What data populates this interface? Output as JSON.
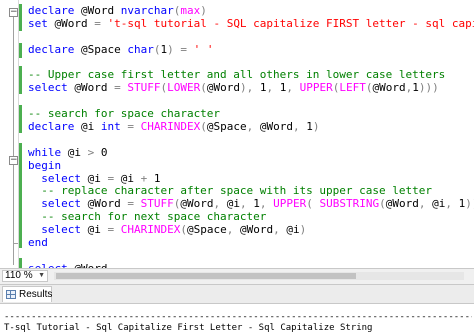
{
  "editor": {
    "lines": [
      [
        {
          "t": "declare",
          "c": "kw"
        },
        {
          "t": " @Word ",
          "c": "pl"
        },
        {
          "t": "nvarchar",
          "c": "kw"
        },
        {
          "t": "(",
          "c": "gr"
        },
        {
          "t": "max",
          "c": "fn"
        },
        {
          "t": ")",
          "c": "gr"
        }
      ],
      [
        {
          "t": "set",
          "c": "kw"
        },
        {
          "t": " @Word ",
          "c": "pl"
        },
        {
          "t": "=",
          "c": "gr"
        },
        {
          "t": " ",
          "c": "pl"
        },
        {
          "t": "'t-sql tutorial - SQL capitalize FIRST letter - sql capitalize string'",
          "c": "str"
        }
      ],
      [],
      [
        {
          "t": "declare",
          "c": "kw"
        },
        {
          "t": " @Space ",
          "c": "pl"
        },
        {
          "t": "char",
          "c": "kw"
        },
        {
          "t": "(",
          "c": "gr"
        },
        {
          "t": "1",
          "c": "pl"
        },
        {
          "t": ")",
          "c": "gr"
        },
        {
          "t": " ",
          "c": "pl"
        },
        {
          "t": "=",
          "c": "gr"
        },
        {
          "t": " ",
          "c": "pl"
        },
        {
          "t": "' '",
          "c": "str"
        }
      ],
      [],
      [
        {
          "t": "-- Upper case first letter and all others in lower case letters",
          "c": "cm"
        }
      ],
      [
        {
          "t": "select",
          "c": "kw"
        },
        {
          "t": " @Word ",
          "c": "pl"
        },
        {
          "t": "=",
          "c": "gr"
        },
        {
          "t": " ",
          "c": "pl"
        },
        {
          "t": "STUFF",
          "c": "fn"
        },
        {
          "t": "(",
          "c": "gr"
        },
        {
          "t": "LOWER",
          "c": "fn"
        },
        {
          "t": "(",
          "c": "gr"
        },
        {
          "t": "@Word",
          "c": "pl"
        },
        {
          "t": "),",
          "c": "gr"
        },
        {
          "t": " 1",
          "c": "pl"
        },
        {
          "t": ",",
          "c": "gr"
        },
        {
          "t": " 1",
          "c": "pl"
        },
        {
          "t": ",",
          "c": "gr"
        },
        {
          "t": " ",
          "c": "pl"
        },
        {
          "t": "UPPER",
          "c": "fn"
        },
        {
          "t": "(",
          "c": "gr"
        },
        {
          "t": "LEFT",
          "c": "fn"
        },
        {
          "t": "(",
          "c": "gr"
        },
        {
          "t": "@Word",
          "c": "pl"
        },
        {
          "t": ",",
          "c": "gr"
        },
        {
          "t": "1",
          "c": "pl"
        },
        {
          "t": ")))",
          "c": "gr"
        }
      ],
      [],
      [
        {
          "t": "-- search for space character",
          "c": "cm"
        }
      ],
      [
        {
          "t": "declare",
          "c": "kw"
        },
        {
          "t": " @i ",
          "c": "pl"
        },
        {
          "t": "int",
          "c": "kw"
        },
        {
          "t": " ",
          "c": "pl"
        },
        {
          "t": "=",
          "c": "gr"
        },
        {
          "t": " ",
          "c": "pl"
        },
        {
          "t": "CHARINDEX",
          "c": "fn"
        },
        {
          "t": "(",
          "c": "gr"
        },
        {
          "t": "@Space",
          "c": "pl"
        },
        {
          "t": ",",
          "c": "gr"
        },
        {
          "t": " @Word",
          "c": "pl"
        },
        {
          "t": ",",
          "c": "gr"
        },
        {
          "t": " 1",
          "c": "pl"
        },
        {
          "t": ")",
          "c": "gr"
        }
      ],
      [],
      [
        {
          "t": "while",
          "c": "kw"
        },
        {
          "t": " @i ",
          "c": "pl"
        },
        {
          "t": ">",
          "c": "gr"
        },
        {
          "t": " 0",
          "c": "pl"
        }
      ],
      [
        {
          "t": "begin",
          "c": "kw"
        }
      ],
      [
        {
          "t": "  ",
          "c": "pl"
        },
        {
          "t": "select",
          "c": "kw"
        },
        {
          "t": " @i ",
          "c": "pl"
        },
        {
          "t": "=",
          "c": "gr"
        },
        {
          "t": " @i ",
          "c": "pl"
        },
        {
          "t": "+",
          "c": "gr"
        },
        {
          "t": " 1",
          "c": "pl"
        }
      ],
      [
        {
          "t": "  -- replace character after space with its upper case letter",
          "c": "cm"
        }
      ],
      [
        {
          "t": "  ",
          "c": "pl"
        },
        {
          "t": "select",
          "c": "kw"
        },
        {
          "t": " @Word ",
          "c": "pl"
        },
        {
          "t": "=",
          "c": "gr"
        },
        {
          "t": " ",
          "c": "pl"
        },
        {
          "t": "STUFF",
          "c": "fn"
        },
        {
          "t": "(",
          "c": "gr"
        },
        {
          "t": "@Word",
          "c": "pl"
        },
        {
          "t": ",",
          "c": "gr"
        },
        {
          "t": " @i",
          "c": "pl"
        },
        {
          "t": ",",
          "c": "gr"
        },
        {
          "t": " 1",
          "c": "pl"
        },
        {
          "t": ",",
          "c": "gr"
        },
        {
          "t": " ",
          "c": "pl"
        },
        {
          "t": "UPPER",
          "c": "fn"
        },
        {
          "t": "(",
          "c": "gr"
        },
        {
          "t": " ",
          "c": "pl"
        },
        {
          "t": "SUBSTRING",
          "c": "fn"
        },
        {
          "t": "(",
          "c": "gr"
        },
        {
          "t": "@Word",
          "c": "pl"
        },
        {
          "t": ",",
          "c": "gr"
        },
        {
          "t": " @i",
          "c": "pl"
        },
        {
          "t": ",",
          "c": "gr"
        },
        {
          "t": " 1",
          "c": "pl"
        },
        {
          "t": "))",
          "c": "gr"
        },
        {
          "t": " ",
          "c": "pl"
        },
        {
          "t": ")",
          "c": "gr"
        }
      ],
      [
        {
          "t": "  -- search for next space character",
          "c": "cm"
        }
      ],
      [
        {
          "t": "  ",
          "c": "pl"
        },
        {
          "t": "select",
          "c": "kw"
        },
        {
          "t": " @i ",
          "c": "pl"
        },
        {
          "t": "=",
          "c": "gr"
        },
        {
          "t": " ",
          "c": "pl"
        },
        {
          "t": "CHARINDEX",
          "c": "fn"
        },
        {
          "t": "(",
          "c": "gr"
        },
        {
          "t": "@Space",
          "c": "pl"
        },
        {
          "t": ",",
          "c": "gr"
        },
        {
          "t": " @Word",
          "c": "pl"
        },
        {
          "t": ",",
          "c": "gr"
        },
        {
          "t": " @i",
          "c": "pl"
        },
        {
          "t": ")",
          "c": "gr"
        }
      ],
      [
        {
          "t": "end",
          "c": "kw"
        }
      ],
      [],
      [
        {
          "t": "select",
          "c": "kw"
        },
        {
          "t": " @Word",
          "c": "pl"
        }
      ]
    ]
  },
  "statusbar": {
    "zoom": "110 %",
    "zoom_arrow": "▼"
  },
  "results_tab": {
    "label": "Results",
    "icon": "results-grid-icon"
  },
  "results": {
    "divider": "------------------------------------------------------------------------------------------------",
    "text": "T-sql Tutorial - Sql Capitalize First Letter - Sql Capitalize String"
  },
  "colors": {
    "keyword": "#0000ff",
    "string": "#ff0000",
    "function": "#ff00ff",
    "comment": "#008000",
    "operator": "#808080",
    "change_bar": "#4caf50"
  }
}
